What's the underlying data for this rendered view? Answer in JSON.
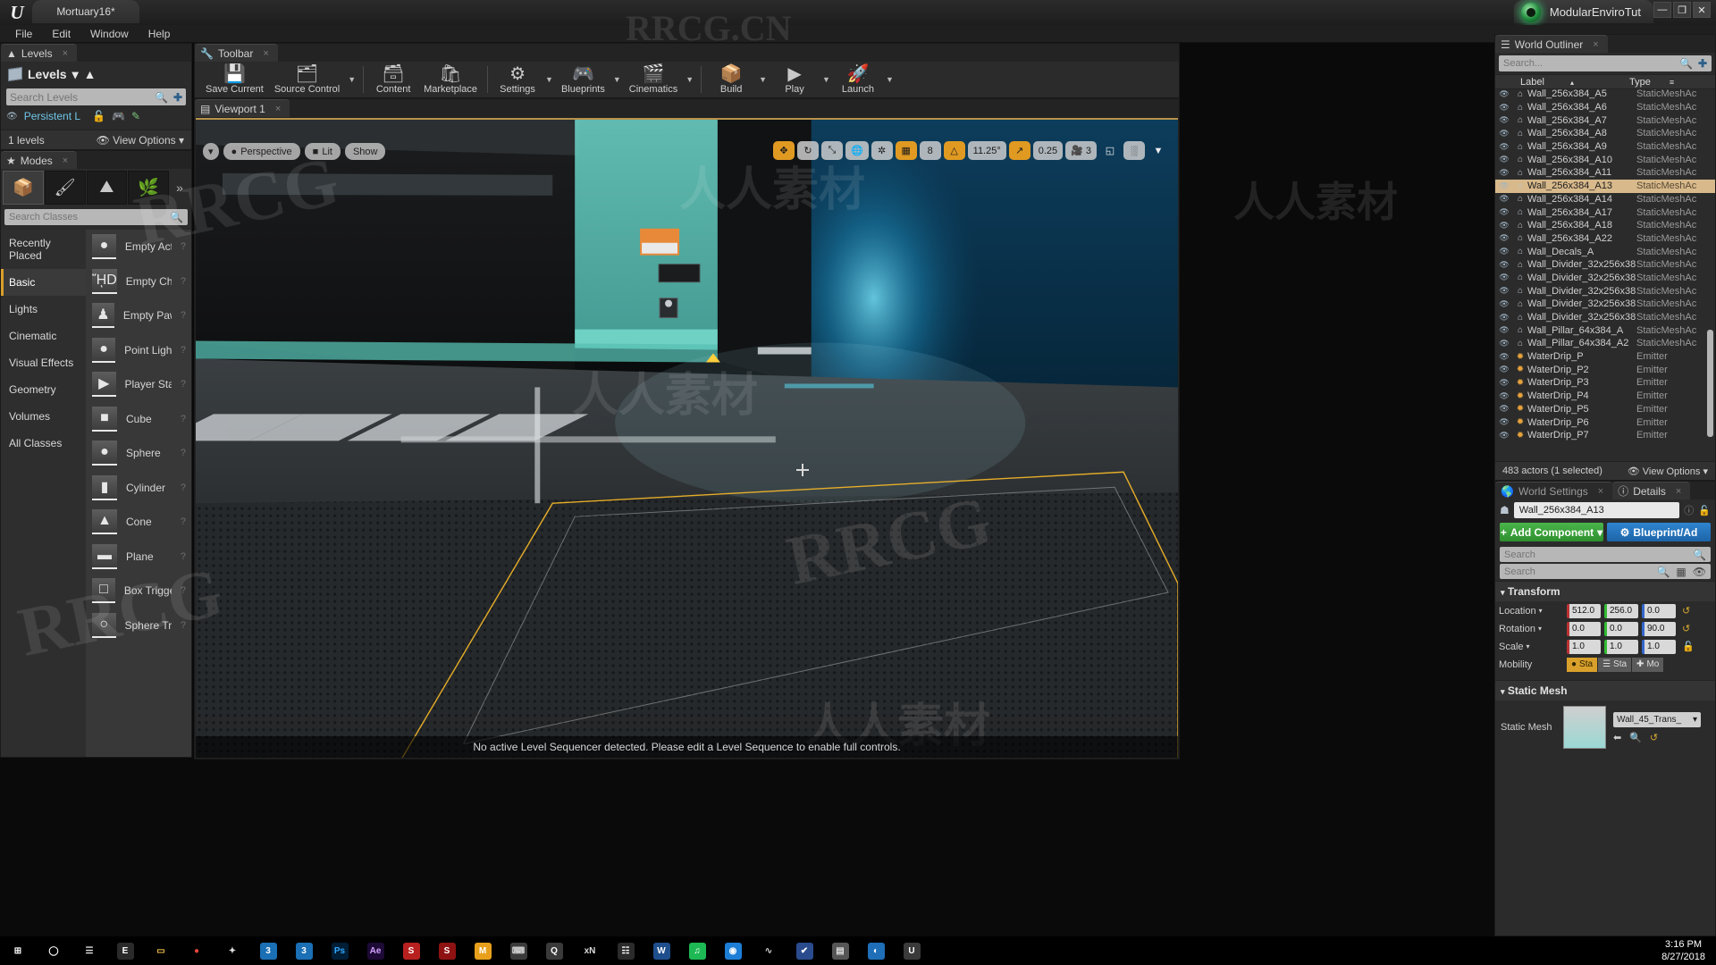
{
  "titlebar": {
    "file_tab": "Mortuary16*",
    "project": "ModularEnviroTut",
    "minimize": "—",
    "maximize": "❐",
    "close": "✕"
  },
  "menu": [
    "File",
    "Edit",
    "Window",
    "Help"
  ],
  "levels_panel": {
    "tab": "Levels",
    "tab_close": "×",
    "header": "Levels",
    "header_caret": "▾",
    "search_placeholder": "Search Levels",
    "search_value": "",
    "search_icon": "search-icon",
    "persistent_level": "Persistent L",
    "footer_count": "1 levels",
    "view_options": "View Options",
    "view_options_caret": "▾"
  },
  "modes_panel": {
    "tab": "Modes",
    "tab_close": "×",
    "mode_icons": [
      "place-mode-icon",
      "paint-mode-icon",
      "landscape-mode-icon",
      "foliage-mode-icon"
    ],
    "more_caret": "»",
    "search_placeholder": "Search Classes",
    "search_value": "",
    "categories": [
      "Recently Placed",
      "Basic",
      "Lights",
      "Cinematic",
      "Visual Effects",
      "Geometry",
      "Volumes",
      "All Classes"
    ],
    "selected_category": "Basic",
    "actors": [
      {
        "label": "Empty Act",
        "icon": "sphere-thumb",
        "help": "?"
      },
      {
        "label": "Empty Cha",
        "icon": "character-thumb",
        "help": "?"
      },
      {
        "label": "Empty Paw",
        "icon": "pawn-thumb",
        "help": "?"
      },
      {
        "label": "Point Light",
        "icon": "pointlight-thumb",
        "help": "?"
      },
      {
        "label": "Player Sta",
        "icon": "playerstart-thumb",
        "help": "?"
      },
      {
        "label": "Cube",
        "icon": "cube-thumb",
        "help": "?"
      },
      {
        "label": "Sphere",
        "icon": "sphere-thumb",
        "help": "?"
      },
      {
        "label": "Cylinder",
        "icon": "cylinder-thumb",
        "help": "?"
      },
      {
        "label": "Cone",
        "icon": "cone-thumb",
        "help": "?"
      },
      {
        "label": "Plane",
        "icon": "plane-thumb",
        "help": "?"
      },
      {
        "label": "Box Trigge",
        "icon": "boxtrigger-thumb",
        "help": "?"
      },
      {
        "label": "Sphere Tri",
        "icon": "spheretrigger-thumb",
        "help": "?"
      }
    ]
  },
  "toolbar": {
    "tab": "Toolbar",
    "tab_close": "×",
    "buttons": [
      {
        "label": "Save Current",
        "icon": "floppy-disk-icon",
        "caret": false
      },
      {
        "label": "Source Control",
        "icon": "source-control-icon",
        "caret": true
      },
      {
        "label": "Content",
        "icon": "content-browser-icon",
        "caret": false
      },
      {
        "label": "Marketplace",
        "icon": "marketplace-bag-icon",
        "caret": false
      },
      {
        "label": "Settings",
        "icon": "gear-icon",
        "caret": true
      },
      {
        "label": "Blueprints",
        "icon": "blueprint-icon",
        "caret": true
      },
      {
        "label": "Cinematics",
        "icon": "clapperboard-icon",
        "caret": true
      },
      {
        "label": "Build",
        "icon": "build-cube-icon",
        "caret": true
      },
      {
        "label": "Play",
        "icon": "play-icon",
        "caret": true
      },
      {
        "label": "Launch",
        "icon": "launch-rocket-icon",
        "caret": true
      }
    ]
  },
  "viewport": {
    "tab": "Viewport 1",
    "tab_close": "×",
    "caret": "▾",
    "view_mode": "Perspective",
    "lit_mode": "Lit",
    "show_menu": "Show",
    "status_text": "No active Level Sequencer detected. Please edit a Level Sequence to enable full controls.",
    "right_controls": [
      {
        "name": "translate-tool",
        "label": "",
        "icon": "move-icon",
        "active": true
      },
      {
        "name": "rotate-tool",
        "label": "",
        "icon": "rotate-icon",
        "active": false
      },
      {
        "name": "scale-tool",
        "label": "",
        "icon": "scale-icon",
        "active": false
      },
      {
        "name": "world-space-toggle",
        "label": "",
        "icon": "globe-icon",
        "active": false
      },
      {
        "name": "surface-snap",
        "label": "",
        "icon": "surface-snap-icon",
        "active": false
      },
      {
        "name": "grid-snap-toggle",
        "label": "",
        "icon": "grid-icon",
        "active": true
      },
      {
        "name": "grid-snap-value",
        "label": "8",
        "icon": "",
        "active": false
      },
      {
        "name": "rotation-snap-toggle",
        "label": "",
        "icon": "angle-icon",
        "active": true
      },
      {
        "name": "rotation-snap-value",
        "label": "11.25°",
        "icon": "",
        "active": false
      },
      {
        "name": "scale-snap-toggle",
        "label": "",
        "icon": "diagonal-arrow-icon",
        "active": true
      },
      {
        "name": "scale-snap-value",
        "label": "0.25",
        "icon": "",
        "active": false
      },
      {
        "name": "camera-speed",
        "label": "3",
        "icon": "camera-speed-icon",
        "active": false
      },
      {
        "name": "maximize-viewport",
        "label": "",
        "icon": "maximize-icon",
        "active": false
      },
      {
        "name": "layout-chooser",
        "label": "",
        "icon": "layout-grid-icon",
        "active": false
      }
    ]
  },
  "outliner": {
    "tab": "World Outliner",
    "tab_close": "×",
    "search_placeholder": "Search...",
    "search_value": "",
    "add_icon": "add-item-icon",
    "columns": {
      "label": "Label",
      "type": "Type",
      "sort_caret": "▴",
      "type_caret": "≡"
    },
    "rows": [
      {
        "label": "Wall_256x384_A5",
        "type": "StaticMeshAc",
        "icon": "static-mesh-icon",
        "selected": false
      },
      {
        "label": "Wall_256x384_A6",
        "type": "StaticMeshAc",
        "icon": "static-mesh-icon",
        "selected": false
      },
      {
        "label": "Wall_256x384_A7",
        "type": "StaticMeshAc",
        "icon": "static-mesh-icon",
        "selected": false
      },
      {
        "label": "Wall_256x384_A8",
        "type": "StaticMeshAc",
        "icon": "static-mesh-icon",
        "selected": false
      },
      {
        "label": "Wall_256x384_A9",
        "type": "StaticMeshAc",
        "icon": "static-mesh-icon",
        "selected": false
      },
      {
        "label": "Wall_256x384_A10",
        "type": "StaticMeshAc",
        "icon": "static-mesh-icon",
        "selected": false
      },
      {
        "label": "Wall_256x384_A11",
        "type": "StaticMeshAc",
        "icon": "static-mesh-icon",
        "selected": false
      },
      {
        "label": "Wall_256x384_A13",
        "type": "StaticMeshAc",
        "icon": "static-mesh-icon",
        "selected": true
      },
      {
        "label": "Wall_256x384_A14",
        "type": "StaticMeshAc",
        "icon": "static-mesh-icon",
        "selected": false
      },
      {
        "label": "Wall_256x384_A17",
        "type": "StaticMeshAc",
        "icon": "static-mesh-icon",
        "selected": false
      },
      {
        "label": "Wall_256x384_A18",
        "type": "StaticMeshAc",
        "icon": "static-mesh-icon",
        "selected": false
      },
      {
        "label": "Wall_256x384_A22",
        "type": "StaticMeshAc",
        "icon": "static-mesh-icon",
        "selected": false
      },
      {
        "label": "Wall_Decals_A",
        "type": "StaticMeshAc",
        "icon": "static-mesh-icon",
        "selected": false
      },
      {
        "label": "Wall_Divider_32x256x38",
        "type": "StaticMeshAc",
        "icon": "static-mesh-icon",
        "selected": false
      },
      {
        "label": "Wall_Divider_32x256x38",
        "type": "StaticMeshAc",
        "icon": "static-mesh-icon",
        "selected": false
      },
      {
        "label": "Wall_Divider_32x256x38",
        "type": "StaticMeshAc",
        "icon": "static-mesh-icon",
        "selected": false
      },
      {
        "label": "Wall_Divider_32x256x38",
        "type": "StaticMeshAc",
        "icon": "static-mesh-icon",
        "selected": false
      },
      {
        "label": "Wall_Divider_32x256x38",
        "type": "StaticMeshAc",
        "icon": "static-mesh-icon",
        "selected": false
      },
      {
        "label": "Wall_Pillar_64x384_A",
        "type": "StaticMeshAc",
        "icon": "static-mesh-icon",
        "selected": false
      },
      {
        "label": "Wall_Pillar_64x384_A2",
        "type": "StaticMeshAc",
        "icon": "static-mesh-icon",
        "selected": false
      },
      {
        "label": "WaterDrip_P",
        "type": "Emitter",
        "icon": "emitter-icon",
        "selected": false
      },
      {
        "label": "WaterDrip_P2",
        "type": "Emitter",
        "icon": "emitter-icon",
        "selected": false
      },
      {
        "label": "WaterDrip_P3",
        "type": "Emitter",
        "icon": "emitter-icon",
        "selected": false
      },
      {
        "label": "WaterDrip_P4",
        "type": "Emitter",
        "icon": "emitter-icon",
        "selected": false
      },
      {
        "label": "WaterDrip_P5",
        "type": "Emitter",
        "icon": "emitter-icon",
        "selected": false
      },
      {
        "label": "WaterDrip_P6",
        "type": "Emitter",
        "icon": "emitter-icon",
        "selected": false
      },
      {
        "label": "WaterDrip_P7",
        "type": "Emitter",
        "icon": "emitter-icon",
        "selected": false
      }
    ],
    "footer_count": "483 actors (1 selected)",
    "view_options": "View Options",
    "view_options_caret": "▾"
  },
  "details": {
    "tabs": [
      {
        "label": "World Settings",
        "icon": "world-icon",
        "active": false
      },
      {
        "label": "Details",
        "icon": "info-icon",
        "active": true
      }
    ],
    "tab_close": "×",
    "actor_name": "Wall_256x384_A13",
    "help_icon": "help-icon",
    "lock_icon": "unlock-icon",
    "add_component": "Add Component",
    "add_component_plus": "+",
    "add_component_caret": "▾",
    "blueprint_button": "Blueprint/Ad",
    "blueprint_icon": "blueprint-gear-icon",
    "search_placeholder_1": "Search",
    "search_placeholder_2": "Search",
    "grid_icon": "grid-view-icon",
    "eye_icon": "eye-icon",
    "transform_section": "Transform",
    "transform": {
      "location_label": "Location",
      "location": [
        "512.0",
        "256.0",
        "0.0"
      ],
      "rotation_label": "Rotation",
      "rotation": [
        "0.0",
        "0.0",
        "90.0"
      ],
      "scale_label": "Scale",
      "scale": [
        "1.0",
        "1.0",
        "1.0"
      ],
      "mobility_label": "Mobility",
      "mobility_options": [
        "Sta",
        "Sta",
        "Mo"
      ],
      "mobility_selected": 0,
      "revert_icon": "↺"
    },
    "static_mesh_section": "Static Mesh",
    "static_mesh_label": "Static Mesh",
    "static_mesh_value": "Wall_45_Trans_",
    "static_mesh_caret": "▾",
    "sm_icons": [
      "back-arrow-icon",
      "browse-icon",
      "reset-icon"
    ]
  },
  "taskbar": {
    "items": [
      {
        "name": "start-button",
        "glyph": "⊞",
        "color": "#ffffff",
        "bg": "transparent"
      },
      {
        "name": "cortana-icon",
        "glyph": "◯",
        "color": "#ffffff",
        "bg": "transparent"
      },
      {
        "name": "task-view-icon",
        "glyph": "☰",
        "color": "#dddddd",
        "bg": "transparent"
      },
      {
        "name": "epic-launcher-icon",
        "glyph": "E",
        "color": "#ffffff",
        "bg": "#2a2a2a"
      },
      {
        "name": "file-explorer-icon",
        "glyph": "▭",
        "color": "#f2c14e",
        "bg": "transparent"
      },
      {
        "name": "chrome-icon",
        "glyph": "●",
        "color": "#e8453c",
        "bg": "transparent"
      },
      {
        "name": "uv-tool-icon",
        "glyph": "✦",
        "color": "#dddddd",
        "bg": "transparent"
      },
      {
        "name": "3dsmax-icon",
        "glyph": "3",
        "color": "#ffffff",
        "bg": "#1a6fb5"
      },
      {
        "name": "3dsmax-2-icon",
        "glyph": "3",
        "color": "#ffffff",
        "bg": "#1a6fb5"
      },
      {
        "name": "photoshop-icon",
        "glyph": "Ps",
        "color": "#31a8ff",
        "bg": "#001e36"
      },
      {
        "name": "aftereffects-icon",
        "glyph": "Ae",
        "color": "#d3a1ff",
        "bg": "#1d0a36"
      },
      {
        "name": "substance-icon",
        "glyph": "S",
        "color": "#ffffff",
        "bg": "#b82020"
      },
      {
        "name": "substance-painter-icon",
        "glyph": "S",
        "color": "#ffffff",
        "bg": "#8f1212"
      },
      {
        "name": "marmoset-icon",
        "glyph": "M",
        "color": "#ffffff",
        "bg": "#e8a01c"
      },
      {
        "name": "terminal-icon",
        "glyph": "⌨",
        "color": "#cccccc",
        "bg": "#3b3b3b"
      },
      {
        "name": "quixel-icon",
        "glyph": "Q",
        "color": "#ffffff",
        "bg": "#3a3a3a"
      },
      {
        "name": "xnormal-icon",
        "glyph": "xN",
        "color": "#dddddd",
        "bg": "transparent"
      },
      {
        "name": "mixamo-icon",
        "glyph": "☷",
        "color": "#ffffff",
        "bg": "#2b2b2b"
      },
      {
        "name": "word-icon",
        "glyph": "W",
        "color": "#ffffff",
        "bg": "#1f4e8c"
      },
      {
        "name": "spotify-icon",
        "glyph": "♫",
        "color": "#ffffff",
        "bg": "#1db954"
      },
      {
        "name": "blue-app-icon",
        "glyph": "◉",
        "color": "#ffffff",
        "bg": "#1c7ed6"
      },
      {
        "name": "curve-tool-icon",
        "glyph": "∿",
        "color": "#cccccc",
        "bg": "transparent"
      },
      {
        "name": "vault-icon",
        "glyph": "✔",
        "color": "#ffffff",
        "bg": "#2a4b8d"
      },
      {
        "name": "notes-icon",
        "glyph": "▤",
        "color": "#dddddd",
        "bg": "#555555"
      },
      {
        "name": "edge-icon",
        "glyph": "◐",
        "color": "#ffffff",
        "bg": "#1e6fb8"
      },
      {
        "name": "unreal-editor-icon",
        "glyph": "U",
        "color": "#ffffff",
        "bg": "#3a3a3a"
      }
    ],
    "pen_icon": "pen-icon",
    "time": "3:16 PM",
    "date": "8/27/2018"
  },
  "watermarks": {
    "brand": "RRCG.CN",
    "cn": "人人素材",
    "abbrev": "RRCG"
  }
}
